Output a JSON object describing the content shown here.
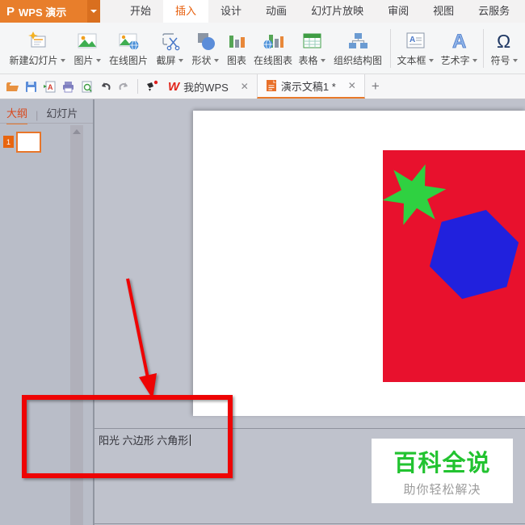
{
  "titlebar": {
    "app_name": "WPS 演示",
    "logo_glyph": "P",
    "tabs": [
      {
        "label": "开始",
        "active": false
      },
      {
        "label": "插入",
        "active": true
      },
      {
        "label": "设计",
        "active": false
      },
      {
        "label": "动画",
        "active": false
      },
      {
        "label": "幻灯片放映",
        "active": false
      },
      {
        "label": "审阅",
        "active": false
      },
      {
        "label": "视图",
        "active": false
      },
      {
        "label": "云服务",
        "active": false
      }
    ]
  },
  "ribbon": {
    "items": [
      {
        "label": "新建幻灯片",
        "dropdown": true
      },
      {
        "label": "图片",
        "dropdown": true
      },
      {
        "label": "在线图片",
        "dropdown": false
      },
      {
        "label": "截屏",
        "dropdown": true
      },
      {
        "label": "形状",
        "dropdown": true
      },
      {
        "label": "图表",
        "dropdown": false
      },
      {
        "label": "在线图表",
        "dropdown": false
      },
      {
        "label": "表格",
        "dropdown": true
      },
      {
        "label": "组织结构图",
        "dropdown": false
      },
      {
        "label": "文本框",
        "dropdown": true
      },
      {
        "label": "艺术字",
        "dropdown": true
      },
      {
        "label": "符号",
        "dropdown": true
      }
    ],
    "wordart_glyph": "A",
    "textbox_glyph": "A",
    "symbol_glyph": "Ω"
  },
  "docbar": {
    "quick_access_icons": [
      "open-folder-icon",
      "save-icon",
      "export-pdf-icon",
      "print-icon",
      "print-preview-icon",
      "undo-icon",
      "redo-icon",
      "paint-tool-icon"
    ],
    "wps_logo_glyph": "W",
    "tabs": [
      {
        "label": "我的WPS",
        "close": "✕",
        "active": false
      },
      {
        "label": "演示文稿1 *",
        "close": "✕",
        "active": true
      }
    ],
    "new_tab_label": "+"
  },
  "sidebar": {
    "tabs": [
      {
        "label": "大纲",
        "active": true
      },
      {
        "label": "幻灯片",
        "active": false
      }
    ],
    "tab_separator": "|",
    "slide_number": "1"
  },
  "slide": {
    "shapes": {
      "rect_color": "#e8112d",
      "star_color": "#2fd141",
      "hexagon_color": "#2121dd"
    }
  },
  "notes": {
    "text": "阳光 六边形 六角形"
  },
  "annotation": {
    "color": "#ee0404"
  },
  "watermark": {
    "title": "百科全说",
    "subtitle": "助你轻松解决",
    "title_color": "#22c330"
  }
}
